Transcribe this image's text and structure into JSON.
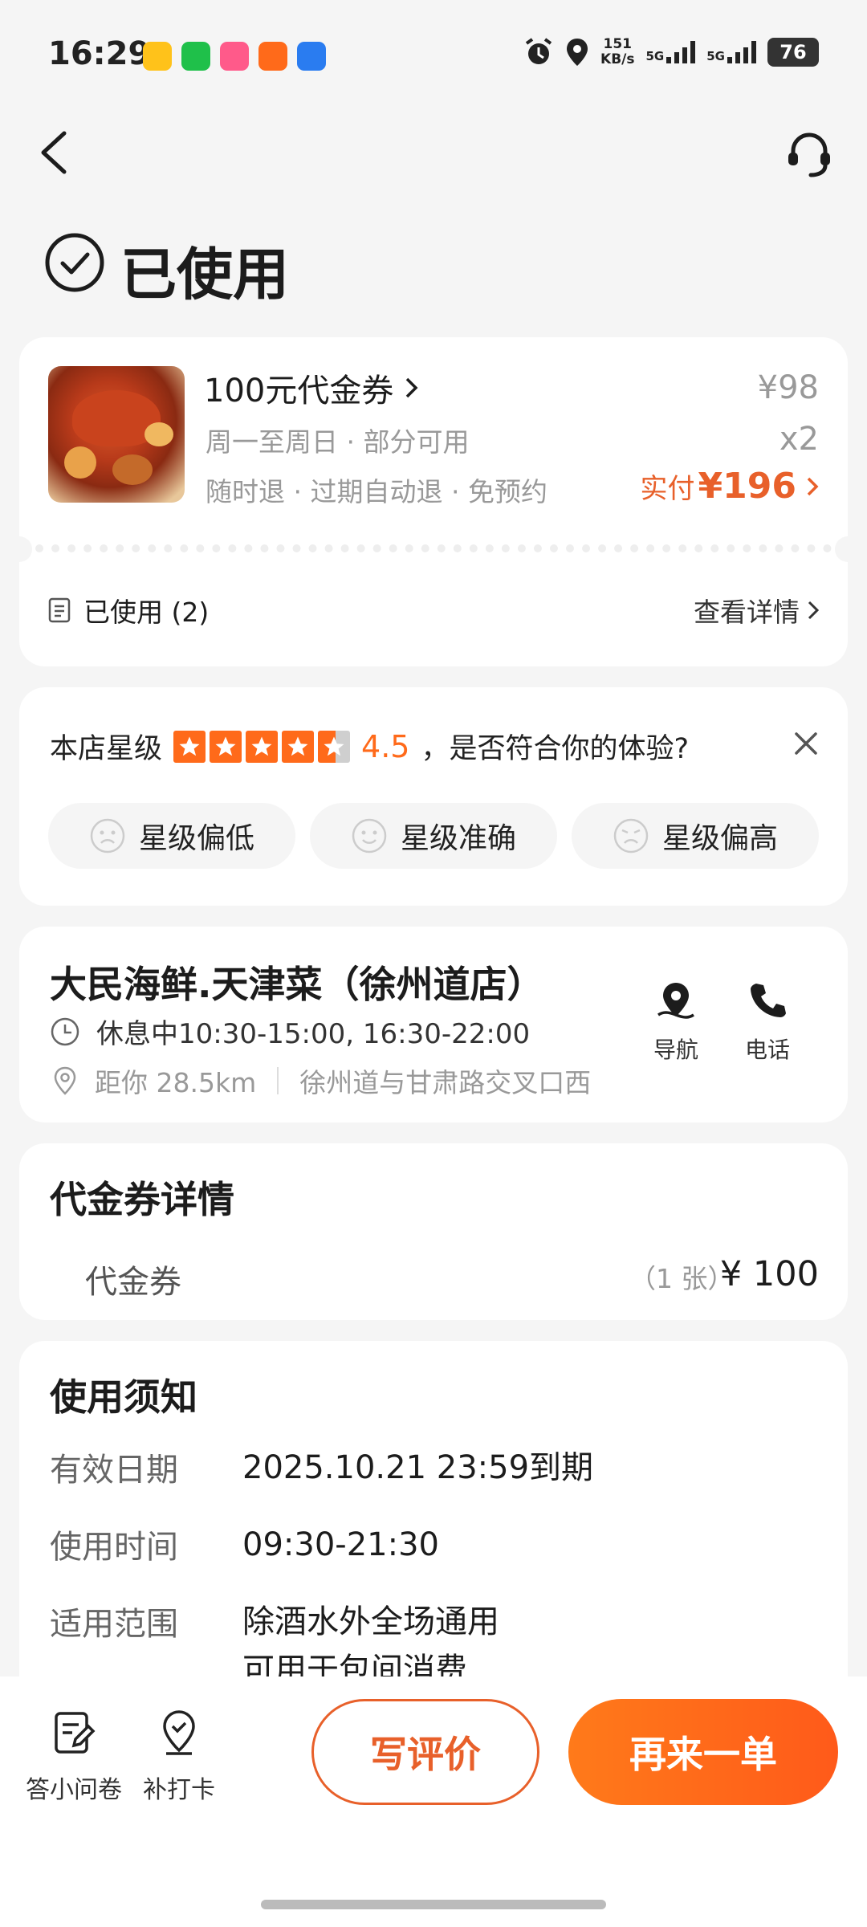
{
  "status_bar": {
    "time": "16:29",
    "net_speed_value": "151",
    "net_speed_unit": "KB/s",
    "signal1": "5G",
    "signal2": "5G",
    "battery": "76",
    "app_icon_colors": [
      "#ffc21a",
      "#1fc04a",
      "#ff5a8a",
      "#ff6a1a",
      "#2a7cf0"
    ]
  },
  "header": {
    "status_title": "已使用"
  },
  "order": {
    "item_title": "100元代金券",
    "item_sub1": "周一至周日 · 部分可用",
    "item_sub2": "随时退 · 过期自动退 · 免预约",
    "price": "¥98",
    "quantity": "x2",
    "paid_label": "实付",
    "paid_amount": "¥196",
    "used_label": "已使用 (2)",
    "detail_link": "查看详情"
  },
  "rating": {
    "prefix": "本店星级",
    "score": "4.5",
    "question": "，是否符合你的体验?",
    "stars_value": 4.5,
    "chips": [
      "星级偏低",
      "星级准确",
      "星级偏高"
    ]
  },
  "shop": {
    "name": "大民海鲜.天津菜（徐州道店）",
    "hours": "休息中10:30-15:00, 16:30-22:00",
    "distance": "距你 28.5km",
    "address": "徐州道与甘肃路交叉口西",
    "nav_label": "导航",
    "call_label": "电话"
  },
  "voucher": {
    "title": "代金券详情",
    "name": "代金券",
    "count": "（1 张）",
    "price": "¥ 100"
  },
  "notice": {
    "title": "使用须知",
    "rows": [
      {
        "label": "有效日期",
        "value": "2025.10.21 23:59到期"
      },
      {
        "label": "使用时间",
        "value": "09:30-21:30"
      },
      {
        "label": "适用范围",
        "value": "除酒水外全场通用"
      }
    ],
    "scope_line2": "可用于包间消费"
  },
  "bottom_bar": {
    "survey_label": "答小问卷",
    "checkin_label": "补打卡",
    "review_button": "写评价",
    "reorder_button": "再来一单"
  },
  "colors": {
    "accent": "#e8602a",
    "star": "#ff6a1a"
  }
}
